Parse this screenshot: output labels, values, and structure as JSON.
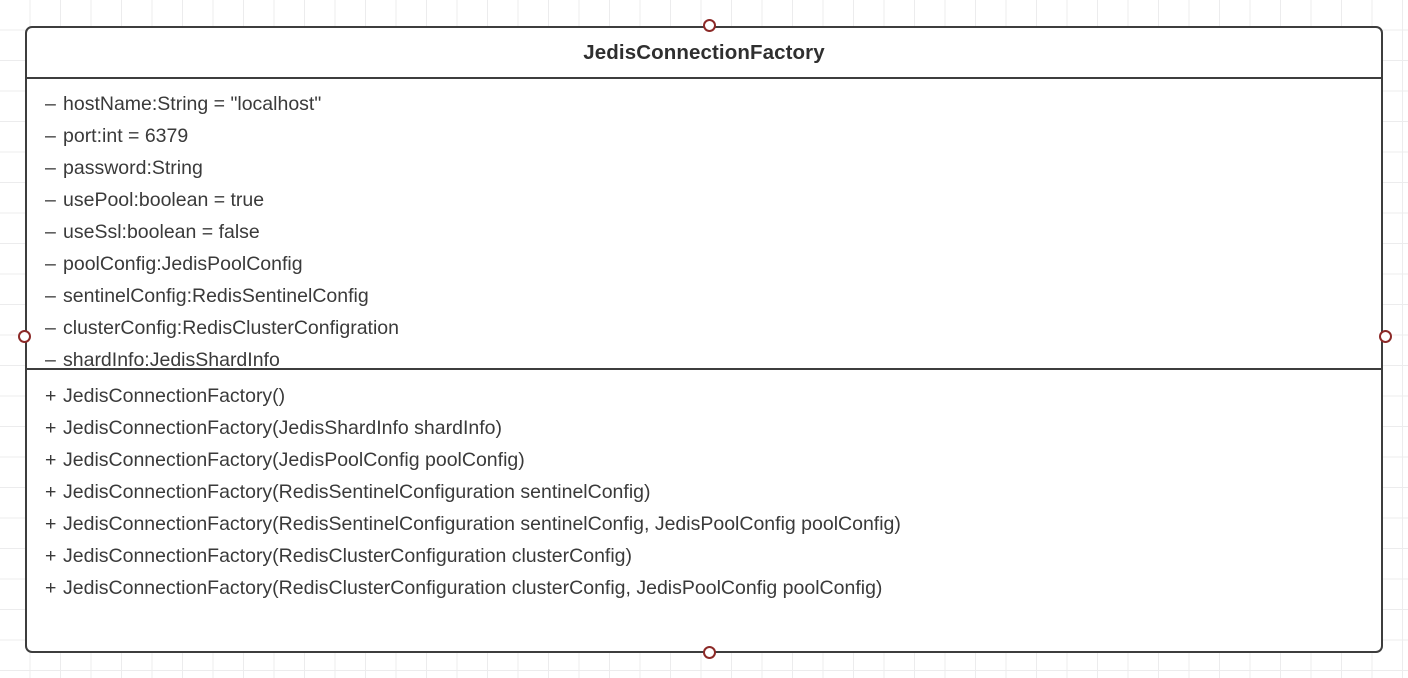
{
  "diagram": {
    "type": "uml-class-diagram",
    "background": "graph-paper-grid",
    "grid_color": "#ececed",
    "canvas_background": "#ffffff"
  },
  "class_box": {
    "name": "JedisConnectionFactory",
    "border_color": "#3d3d3d",
    "fill_color": "#ffffff",
    "text_color": "#3a3a3a",
    "attributes": [
      {
        "visibility": "–",
        "signature": "hostName:String = \"localhost\""
      },
      {
        "visibility": "–",
        "signature": "port:int = 6379"
      },
      {
        "visibility": "–",
        "signature": "password:String"
      },
      {
        "visibility": "–",
        "signature": "usePool:boolean = true"
      },
      {
        "visibility": "–",
        "signature": "useSsl:boolean = false"
      },
      {
        "visibility": "–",
        "signature": "poolConfig:JedisPoolConfig"
      },
      {
        "visibility": "–",
        "signature": "sentinelConfig:RedisSentinelConfig"
      },
      {
        "visibility": "–",
        "signature": "clusterConfig:RedisClusterConfigration"
      },
      {
        "visibility": "–",
        "signature": "shardInfo:JedisShardInfo"
      }
    ],
    "operations": [
      {
        "visibility": "+",
        "signature": "JedisConnectionFactory()"
      },
      {
        "visibility": "+",
        "signature": "JedisConnectionFactory(JedisShardInfo shardInfo)"
      },
      {
        "visibility": "+",
        "signature": "JedisConnectionFactory(JedisPoolConfig poolConfig)"
      },
      {
        "visibility": "+",
        "signature": "JedisConnectionFactory(RedisSentinelConfiguration sentinelConfig)"
      },
      {
        "visibility": "+",
        "signature": "JedisConnectionFactory(RedisSentinelConfiguration sentinelConfig, JedisPoolConfig poolConfig)"
      },
      {
        "visibility": "+",
        "signature": "JedisConnectionFactory(RedisClusterConfiguration clusterConfig)"
      },
      {
        "visibility": "+",
        "signature": "JedisConnectionFactory(RedisClusterConfiguration clusterConfig, JedisPoolConfig poolConfig)"
      }
    ]
  },
  "handles": {
    "color": "#8c2a28",
    "fill": "#ffffff",
    "positions": [
      "top",
      "right",
      "bottom",
      "left"
    ]
  }
}
